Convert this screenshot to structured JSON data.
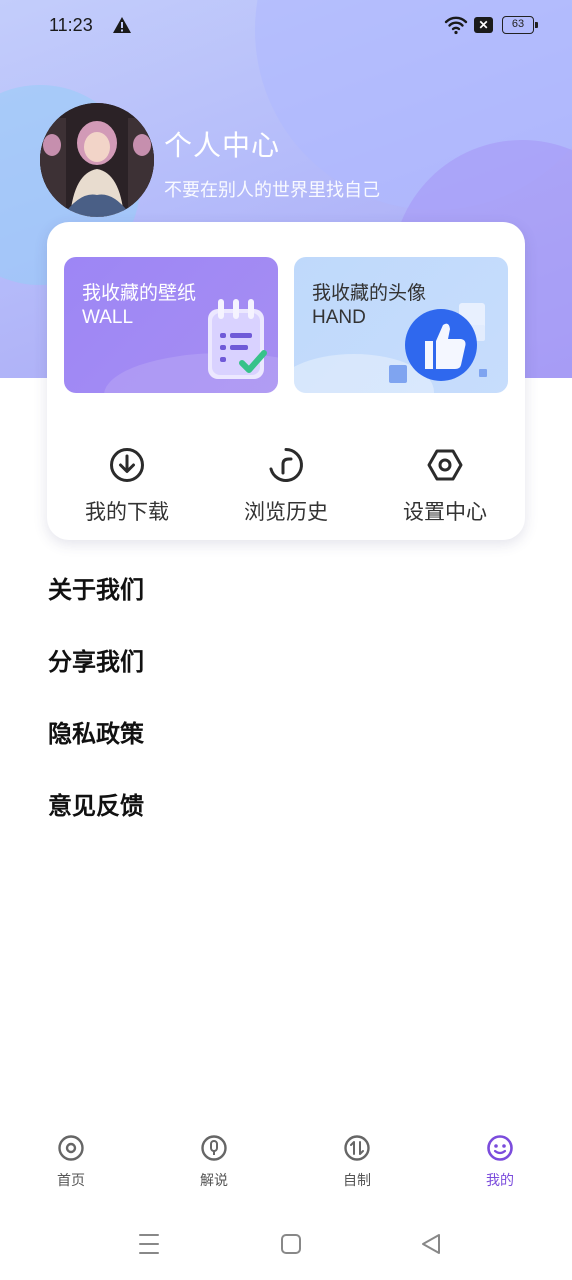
{
  "status_bar": {
    "time": "11:23",
    "battery": "63",
    "x_badge": "✕",
    "icons": [
      "warning-icon",
      "wifi-icon"
    ]
  },
  "profile": {
    "title": "个人中心",
    "subtitle": "不要在别人的世界里找自己"
  },
  "favorites": [
    {
      "title": "我收藏的壁纸",
      "subtitle": "WALL",
      "icon": "notepad-check-icon",
      "color": "#9d86f5"
    },
    {
      "title": "我收藏的头像",
      "subtitle": "HAND",
      "icon": "thumbs-up-icon",
      "color": "#bfd9fb"
    }
  ],
  "quick_actions": [
    {
      "label": "我的下载",
      "icon": "download-icon"
    },
    {
      "label": "浏览历史",
      "icon": "history-icon"
    },
    {
      "label": "设置中心",
      "icon": "settings-icon"
    }
  ],
  "menu": [
    {
      "label": "关于我们"
    },
    {
      "label": "分享我们"
    },
    {
      "label": "隐私政策"
    },
    {
      "label": "意见反馈"
    }
  ],
  "tabs": [
    {
      "label": "首页",
      "icon": "disc-icon",
      "active": false
    },
    {
      "label": "解说",
      "icon": "microphone-icon",
      "active": false
    },
    {
      "label": "自制",
      "icon": "swap-icon",
      "active": false
    },
    {
      "label": "我的",
      "icon": "smile-icon",
      "active": true
    }
  ],
  "nav": {
    "icons": [
      "menu-icon",
      "home-square-icon",
      "back-triangle-icon"
    ]
  },
  "colors": {
    "accent": "#7b4cdc",
    "header_gradient_end": "#a8a4f4",
    "text_dark": "#111111"
  }
}
